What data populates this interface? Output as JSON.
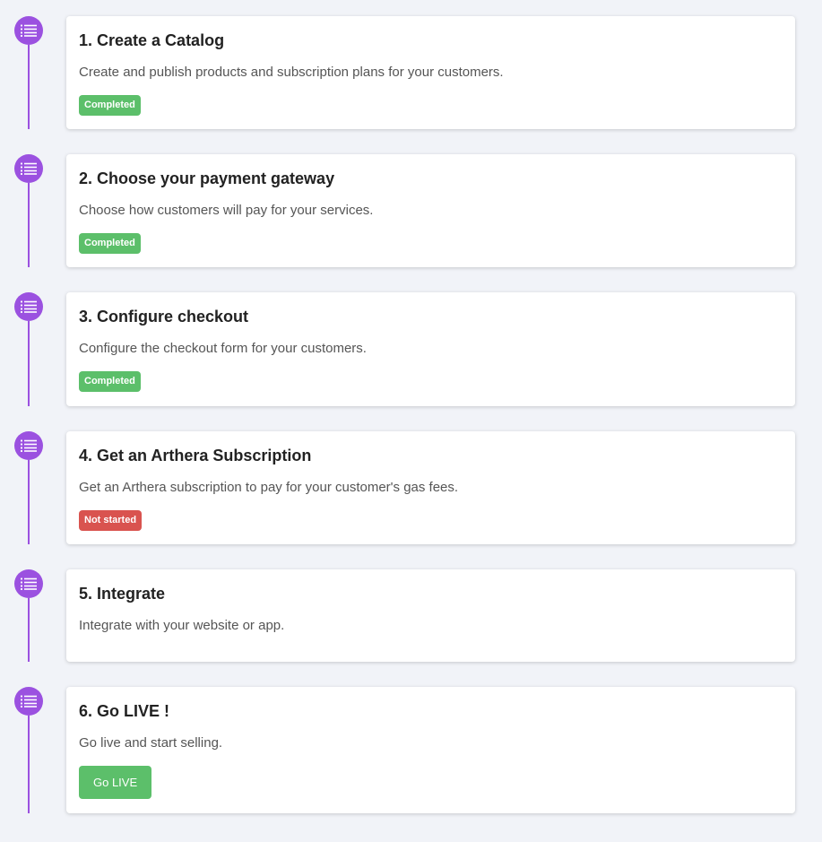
{
  "colors": {
    "accent": "#9b51e0",
    "completed": "#5cbf6a",
    "not_started": "#d9534f"
  },
  "steps": [
    {
      "icon": "list-icon",
      "title": "1. Create a Catalog",
      "description": "Create and publish products and subscription plans for your customers.",
      "status": "Completed"
    },
    {
      "icon": "list-icon",
      "title": "2. Choose your payment gateway",
      "description": "Choose how customers will pay for your services.",
      "status": "Completed"
    },
    {
      "icon": "list-icon",
      "title": "3. Configure checkout",
      "description": "Configure the checkout form for your customers.",
      "status": "Completed"
    },
    {
      "icon": "list-icon",
      "title": "4. Get an Arthera Subscription",
      "description": "Get an Arthera subscription to pay for your customer's gas fees.",
      "status": "Not started"
    },
    {
      "icon": "list-icon",
      "title": "5. Integrate",
      "description": "Integrate with your website or app."
    },
    {
      "icon": "list-icon",
      "title": "6. Go LIVE !",
      "description": "Go live and start selling.",
      "button_label": "Go LIVE"
    }
  ]
}
